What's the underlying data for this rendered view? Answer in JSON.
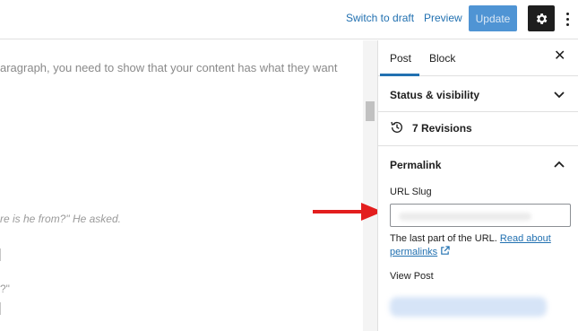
{
  "topbar": {
    "switch_to_draft": "Switch to draft",
    "preview": "Preview",
    "update": "Update",
    "settings_icon": "gear-icon",
    "more_icon": "more-vertical-icon",
    "colors": {
      "update_bg": "#4f94d4",
      "settings_bg": "#1e1e1e",
      "link": "#2271b1"
    }
  },
  "editor": {
    "line1": "aragraph, you need to show that your content has what they want",
    "line2": "re is he from?\" He asked.",
    "line3": "?\""
  },
  "sidebar": {
    "tabs": [
      {
        "label": "Post",
        "active": true
      },
      {
        "label": "Block",
        "active": false
      }
    ],
    "close_icon": "close-icon",
    "status_visibility": "Status & visibility",
    "revisions": "7 Revisions",
    "revisions_icon": "history-icon",
    "permalink": {
      "title": "Permalink",
      "url_slug_label": "URL Slug",
      "url_slug_value": "",
      "help_text": "The last part of the URL.",
      "read_about": "Read about",
      "permalinks": "permalinks",
      "external_icon": "external-link-icon",
      "view_post": "View Post"
    }
  },
  "annotation": {
    "arrow_icon": "red-arrow-icon",
    "color": "#e31e1e"
  }
}
